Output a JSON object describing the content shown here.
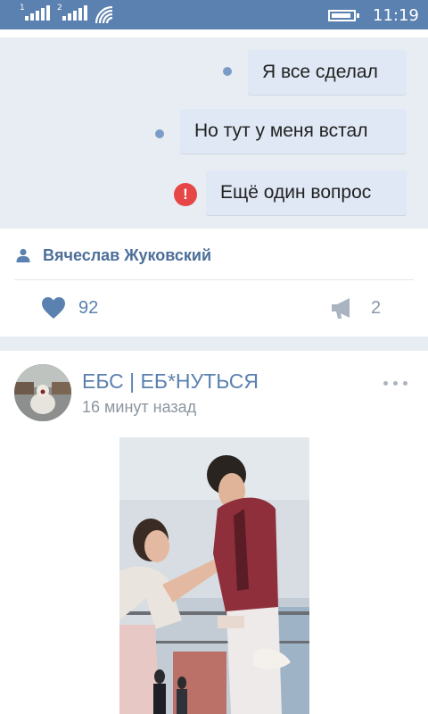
{
  "status_bar": {
    "sim1_label": "1",
    "sim2_label": "2",
    "time": "11:19",
    "icons": [
      "signal-icon",
      "signal-icon",
      "wifi-icon",
      "battery-icon"
    ]
  },
  "messages": [
    {
      "text": "Я все сделал",
      "status": "unread-dot"
    },
    {
      "text": "Но тут у меня встал",
      "status": "unread-dot"
    },
    {
      "text": "Ещё один вопрос",
      "status": "error"
    }
  ],
  "post_footer": {
    "author": "Вячеслав Жуковский",
    "likes": "92",
    "shares": "2"
  },
  "post": {
    "group_name": "ЕБС | ЕБ*НУТЬСЯ",
    "time": "16 минут назад"
  },
  "colors": {
    "status_bar": "#5b81b0",
    "accent": "#5b81b0",
    "error": "#e64646",
    "bubble": "#dfe8f4",
    "panel": "#e8edf3"
  }
}
